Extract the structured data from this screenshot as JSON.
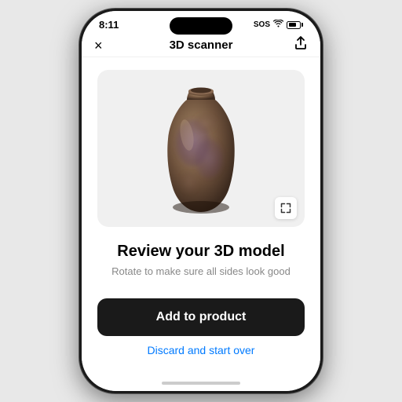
{
  "status_bar": {
    "time": "8:11",
    "sos": "SOS",
    "icons": [
      "wifi",
      "signal",
      "battery"
    ]
  },
  "nav": {
    "title": "3D scanner",
    "close_label": "×",
    "share_label": "↑"
  },
  "model_section": {
    "expand_icon": "⤢"
  },
  "text": {
    "main_title": "Review your 3D model",
    "subtitle": "Rotate to make sure all sides look good"
  },
  "actions": {
    "add_button_label": "Add to product",
    "discard_label": "Discard and start over"
  },
  "colors": {
    "add_button_bg": "#1a1a1a",
    "add_button_text": "#ffffff",
    "discard_text": "#007AFF"
  }
}
